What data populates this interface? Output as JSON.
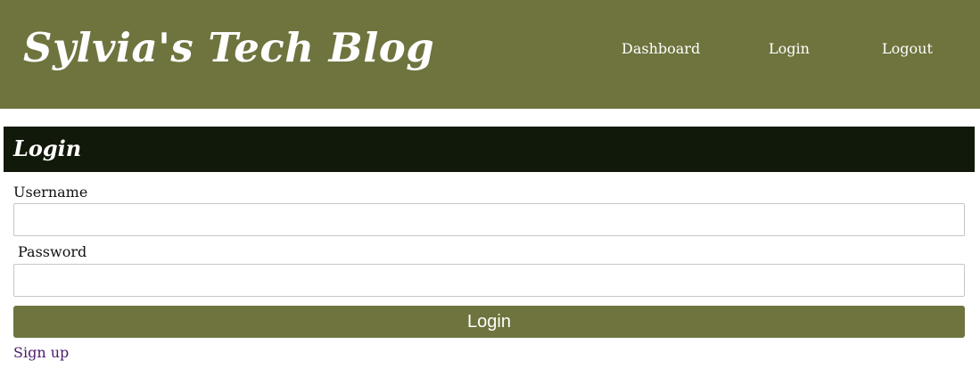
{
  "header": {
    "site_title": "Sylvia's Tech Blog",
    "nav": {
      "dashboard": "Dashboard",
      "login": "Login",
      "logout": "Logout"
    }
  },
  "login_form": {
    "title": "Login",
    "username_label": "Username",
    "username_value": "",
    "password_label": "Password",
    "password_value": "",
    "submit_label": "Login",
    "signup_link": "Sign up"
  },
  "colors": {
    "header_bg": "#6f743e",
    "card_header_bg": "#11190a",
    "button_bg": "#6f743e",
    "link_visited": "#4a1a6e"
  }
}
